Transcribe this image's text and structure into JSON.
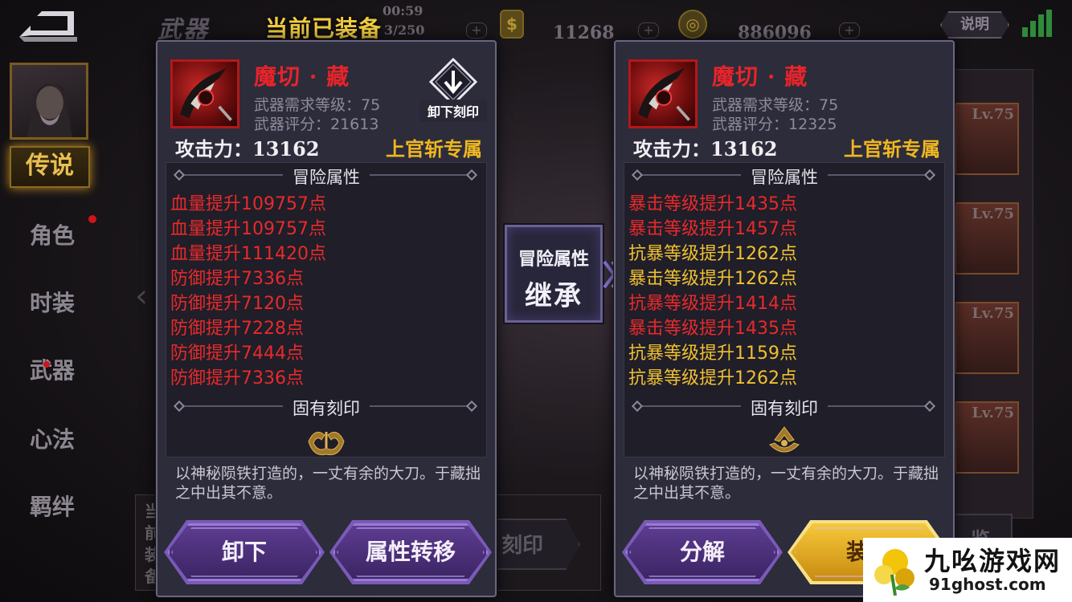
{
  "topbar": {
    "section_title": "武器",
    "time": "00:59",
    "count": "3/250",
    "currency1_value": "11268",
    "currency2_value": "886096",
    "explain_label": "说明",
    "plus": "+",
    "currency1_glyph": "$"
  },
  "equipped_label": "当前已装备",
  "sidebar": {
    "active_item": "传说",
    "items": [
      "角色",
      "时装",
      "武器",
      "心法",
      "羁绊"
    ]
  },
  "background": {
    "slot_labels": [
      "Lv.75",
      "Lv.75",
      "Lv.75",
      "Lv.75"
    ],
    "panel_chars": "当前装备",
    "engrave_btn": "刻印",
    "right_btn": "览"
  },
  "left_panel": {
    "weapon_name": "魔切 · 藏",
    "level_req": "武器需求等级：75",
    "score": "武器评分：21613",
    "attack": "攻击力：13162",
    "exclusive": "上官斩专属",
    "unload_engrave_label": "卸下刻印",
    "adventure_title": "冒险属性",
    "attributes": [
      {
        "text": "血量提升109757点",
        "color": "red"
      },
      {
        "text": "血量提升109757点",
        "color": "red"
      },
      {
        "text": "血量提升111420点",
        "color": "red"
      },
      {
        "text": "防御提升7336点",
        "color": "red"
      },
      {
        "text": "防御提升7120点",
        "color": "red"
      },
      {
        "text": "防御提升7228点",
        "color": "red"
      },
      {
        "text": "防御提升7444点",
        "color": "red"
      },
      {
        "text": "防御提升7336点",
        "color": "red"
      }
    ],
    "engrave_title": "固有刻印",
    "description": "以神秘陨铁打造的，一丈有余的大刀。于藏拙之中出其不意。",
    "button_left": "卸下",
    "button_right": "属性转移"
  },
  "inherit": {
    "line1": "冒险属性",
    "line2": "继承"
  },
  "right_panel": {
    "weapon_name": "魔切 · 藏",
    "level_req": "武器需求等级：75",
    "score": "武器评分：12325",
    "attack": "攻击力：13162",
    "exclusive": "上官斩专属",
    "adventure_title": "冒险属性",
    "attributes": [
      {
        "text": "暴击等级提升1435点",
        "color": "red"
      },
      {
        "text": "暴击等级提升1457点",
        "color": "red"
      },
      {
        "text": "抗暴等级提升1262点",
        "color": "gold"
      },
      {
        "text": "暴击等级提升1262点",
        "color": "gold"
      },
      {
        "text": "抗暴等级提升1414点",
        "color": "red"
      },
      {
        "text": "暴击等级提升1435点",
        "color": "red"
      },
      {
        "text": "抗暴等级提升1159点",
        "color": "gold"
      },
      {
        "text": "抗暴等级提升1262点",
        "color": "gold"
      }
    ],
    "engrave_title": "固有刻印",
    "description": "以神秘陨铁打造的，一丈有余的大刀。于藏拙之中出其不意。",
    "button_left": "分解",
    "button_right": "装备"
  },
  "watermark": {
    "name": "九吆游戏网",
    "url": "91ghost.com"
  },
  "colors": {
    "attr_red": "#e82a2a",
    "attr_gold": "#f0c030",
    "exclusive_gold": "#f0b820",
    "weapon_name_red": "#e8242a",
    "panel_bg": "#2d2c3a",
    "button_purple": "#4a2f7a",
    "button_gold": "#e0a820"
  }
}
